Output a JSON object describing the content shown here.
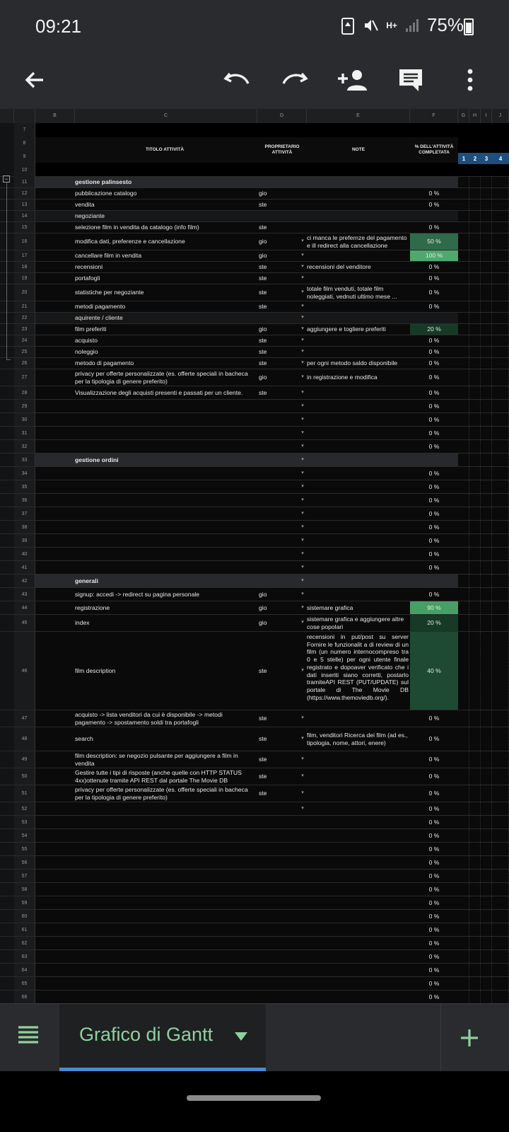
{
  "status_bar": {
    "time": "09:21",
    "battery": "75%",
    "network": "H+"
  },
  "sheet": {
    "columns": [
      "B",
      "C",
      "D",
      "E",
      "F",
      "G",
      "H",
      "I",
      "J"
    ],
    "header_row_numbers": [
      "7",
      "8",
      "9",
      "10"
    ],
    "header": {
      "title": "TITOLO ATTIVITÀ",
      "owner": "PROPRIETARIO ATTIVITÀ",
      "notes": "NOTE",
      "pct": "% DELL'ATTIVITÀ COMPLETATA"
    },
    "gantt_days": [
      "1",
      "2",
      "3",
      "4"
    ],
    "rows": [
      {
        "n": "11",
        "title": "gestione palinsesto",
        "owner": "",
        "note": "",
        "pct": "",
        "type": "section",
        "dd": false
      },
      {
        "n": "12",
        "title": "pubblicazione catalogo",
        "owner": "gio",
        "note": "",
        "pct": "0 %",
        "dd": false
      },
      {
        "n": "13",
        "title": "vendita",
        "owner": "ste",
        "note": "",
        "pct": "0 %",
        "dd": false
      },
      {
        "n": "14",
        "title": "negoziante",
        "owner": "",
        "note": "",
        "pct": "",
        "type": "light",
        "dd": false
      },
      {
        "n": "15",
        "title": "selezione film in vendita da catalogo (info film)",
        "owner": "ste",
        "note": "",
        "pct": "0 %",
        "dd": false
      },
      {
        "n": "16",
        "title": "modifica dati, preferenze e cancellazione",
        "owner": "gio",
        "note": "ci manca le prefernze del pagamento e ill redirect alla cancellazione",
        "pct": "50 %",
        "h": 24,
        "fill": "#2f6b4a",
        "dd": true
      },
      {
        "n": "17",
        "title": "cancellare film in vendita",
        "owner": "gio",
        "note": "",
        "pct": "100 %",
        "fill": "#4fa86d",
        "dd": true
      },
      {
        "n": "18",
        "title": "recensioni",
        "owner": "ste",
        "note": "recensioni del venditore",
        "pct": "0 %",
        "dd": true
      },
      {
        "n": "19",
        "title": "portafogli",
        "owner": "ste",
        "note": "",
        "pct": "0 %",
        "dd": true
      },
      {
        "n": "20",
        "title": "statistiche per negoziante",
        "owner": "ste",
        "note": "totale film venduti, totale film noleggiati, vednuti ultimo mese ...",
        "pct": "0 %",
        "h": 24,
        "dd": true
      },
      {
        "n": "21",
        "title": "metodi pagamento",
        "owner": "ste",
        "note": "",
        "pct": "0 %",
        "dd": true
      },
      {
        "n": "22",
        "title": "aquirente / cliente",
        "owner": "",
        "note": "",
        "pct": "",
        "type": "light",
        "dd": true
      },
      {
        "n": "23",
        "title": "film preferiti",
        "owner": "gio",
        "note": "aggiungere e togliere preferiti",
        "pct": "20 %",
        "fill": "#163a26",
        "dd": true
      },
      {
        "n": "24",
        "title": "acquisto",
        "owner": "ste",
        "note": "",
        "pct": "0 %",
        "dd": true
      },
      {
        "n": "25",
        "title": "noleggio",
        "owner": "ste",
        "note": "",
        "pct": "0 %",
        "dd": true
      },
      {
        "n": "26",
        "title": "metodo di pagamento",
        "owner": "ste",
        "note": "per ogni metodo saldo disponibile",
        "pct": "0 %",
        "dd": true
      },
      {
        "n": "27",
        "title": "privacy per offerte personalizzate (es. offerte speciali in bacheca per la tipologia di genere preferito)",
        "owner": "gio",
        "note": "in registrazione e modifica",
        "pct": "0 %",
        "h": 24,
        "dd": true
      },
      {
        "n": "28",
        "title": "Visualizzazione degli acquisti presenti e passati per un cliente.",
        "owner": "ste",
        "note": "",
        "pct": "0 %",
        "h": 19,
        "dd": true
      },
      {
        "n": "29",
        "title": "",
        "owner": "",
        "note": "",
        "pct": "0 %",
        "h": 19,
        "dd": true
      },
      {
        "n": "30",
        "title": "",
        "owner": "",
        "note": "",
        "pct": "0 %",
        "h": 19,
        "dd": true
      },
      {
        "n": "31",
        "title": "",
        "owner": "",
        "note": "",
        "pct": "0 %",
        "h": 19,
        "dd": true
      },
      {
        "n": "32",
        "title": "",
        "owner": "",
        "note": "",
        "pct": "0 %",
        "h": 19,
        "dd": true
      },
      {
        "n": "33",
        "title": "gestione ordini",
        "owner": "",
        "note": "",
        "pct": "",
        "type": "section",
        "h": 19,
        "dd": true
      },
      {
        "n": "34",
        "title": "",
        "owner": "",
        "note": "",
        "pct": "0 %",
        "h": 19,
        "dd": true
      },
      {
        "n": "35",
        "title": "",
        "owner": "",
        "note": "",
        "pct": "0 %",
        "h": 19,
        "dd": true
      },
      {
        "n": "36",
        "title": "",
        "owner": "",
        "note": "",
        "pct": "0 %",
        "h": 19,
        "dd": true
      },
      {
        "n": "37",
        "title": "",
        "owner": "",
        "note": "",
        "pct": "0 %",
        "h": 19,
        "dd": true
      },
      {
        "n": "38",
        "title": "",
        "owner": "",
        "note": "",
        "pct": "0 %",
        "h": 19,
        "dd": true
      },
      {
        "n": "39",
        "title": "",
        "owner": "",
        "note": "",
        "pct": "0 %",
        "h": 19,
        "dd": true
      },
      {
        "n": "40",
        "title": "",
        "owner": "",
        "note": "",
        "pct": "0 %",
        "h": 19,
        "dd": true
      },
      {
        "n": "41",
        "title": "",
        "owner": "",
        "note": "",
        "pct": "0 %",
        "h": 19,
        "dd": true
      },
      {
        "n": "42",
        "title": "generali",
        "owner": "",
        "note": "",
        "pct": "",
        "type": "section",
        "h": 19,
        "dd": true
      },
      {
        "n": "43",
        "title": "signup: accedi -> redirect su pagina personale",
        "owner": "gio",
        "note": "",
        "pct": "0 %",
        "h": 19,
        "dd": true
      },
      {
        "n": "44",
        "title": "registrazione",
        "owner": "gio",
        "note": "sistemare grafica",
        "pct": "90 %",
        "h": 19,
        "fill": "#46a066",
        "dd": true
      },
      {
        "n": "45",
        "title": "index",
        "owner": "gio",
        "note": "sistemare grafica e aggiungere altre cose popolari",
        "pct": "20 %",
        "h": 24,
        "fill": "#163a26",
        "dd": true
      },
      {
        "n": "46",
        "title": "film description",
        "owner": "ste",
        "note": "recensioni in put/post su server Fornire le funzionalit a di review di un film (un numero internocompreso tra 0 e 5 stelle) per ogni utente finale registrato e dopoaver verificato che i dati inseriti siano corretti, postarlo tramiteAPI REST (PUT/UPDATE) sul portale di The Movie DB (https://www.themoviedb.org/).",
        "pct": "40 %",
        "h": 111,
        "fill": "#1e4a33",
        "dd": true
      },
      {
        "n": "47",
        "title": "acquisto -> lista venditori da cui è disponibile -> metodi pagamento -> spostamento soldi tra portafogli",
        "owner": "ste",
        "note": "",
        "pct": "0 %",
        "h": 24,
        "dd": true
      },
      {
        "n": "48",
        "title": "search",
        "owner": "ste",
        "note": "film, venditori Ricerca dei film (ad es., tipologia, nome, attori, enere)",
        "pct": "0 %",
        "h": 34,
        "dd": true
      },
      {
        "n": "49",
        "title": "film description: se negozio pulsante per aggiungere a film in vendita",
        "owner": "ste",
        "note": "",
        "pct": "0 %",
        "h": 24,
        "dd": true
      },
      {
        "n": "50",
        "title": "Gestire tutte i tipi di risposte (anche quelle con HTTP STATUS 4xx)ottenute tramite API REST dal portale The Movie DB",
        "owner": "ste",
        "note": "",
        "pct": "0 %",
        "h": 24,
        "dd": true
      },
      {
        "n": "51",
        "title": "privacy per offerte personalizzate (es. offerte speciali in bacheca per la tipologia di genere preferito)",
        "owner": "ste",
        "note": "",
        "pct": "0 %",
        "h": 24,
        "dd": true
      },
      {
        "n": "52",
        "title": "",
        "owner": "",
        "note": "",
        "pct": "0 %",
        "h": 19,
        "dd": true
      },
      {
        "n": "53",
        "title": "",
        "owner": "",
        "note": "",
        "pct": "0 %",
        "h": 19,
        "dd": false
      },
      {
        "n": "54",
        "title": "",
        "owner": "",
        "note": "",
        "pct": "0 %",
        "h": 19,
        "dd": false
      },
      {
        "n": "55",
        "title": "",
        "owner": "",
        "note": "",
        "pct": "0 %",
        "h": 19,
        "dd": false
      },
      {
        "n": "56",
        "title": "",
        "owner": "",
        "note": "",
        "pct": "0 %",
        "h": 19,
        "dd": false
      },
      {
        "n": "57",
        "title": "",
        "owner": "",
        "note": "",
        "pct": "0 %",
        "h": 19,
        "dd": false
      },
      {
        "n": "58",
        "title": "",
        "owner": "",
        "note": "",
        "pct": "0 %",
        "h": 19,
        "dd": false
      },
      {
        "n": "59",
        "title": "",
        "owner": "",
        "note": "",
        "pct": "0 %",
        "h": 19,
        "dd": false
      },
      {
        "n": "60",
        "title": "",
        "owner": "",
        "note": "",
        "pct": "0 %",
        "h": 19,
        "dd": false
      },
      {
        "n": "61",
        "title": "",
        "owner": "",
        "note": "",
        "pct": "0 %",
        "h": 19,
        "dd": false
      },
      {
        "n": "62",
        "title": "",
        "owner": "",
        "note": "",
        "pct": "0 %",
        "h": 19,
        "dd": false
      },
      {
        "n": "63",
        "title": "",
        "owner": "",
        "note": "",
        "pct": "0 %",
        "h": 19,
        "dd": false
      },
      {
        "n": "64",
        "title": "",
        "owner": "",
        "note": "",
        "pct": "0 %",
        "h": 19,
        "dd": false
      },
      {
        "n": "65",
        "title": "",
        "owner": "",
        "note": "",
        "pct": "0 %",
        "h": 19,
        "dd": false
      },
      {
        "n": "66",
        "title": "",
        "owner": "",
        "note": "",
        "pct": "0 %",
        "h": 19,
        "dd": false
      }
    ]
  },
  "bottom_bar": {
    "sheet_tab": "Grafico di Gantt"
  },
  "colors": {
    "accent_green": "#8fd19e",
    "tab_indicator": "#4a8ad6",
    "gantt_header": "#1e4e7e"
  }
}
